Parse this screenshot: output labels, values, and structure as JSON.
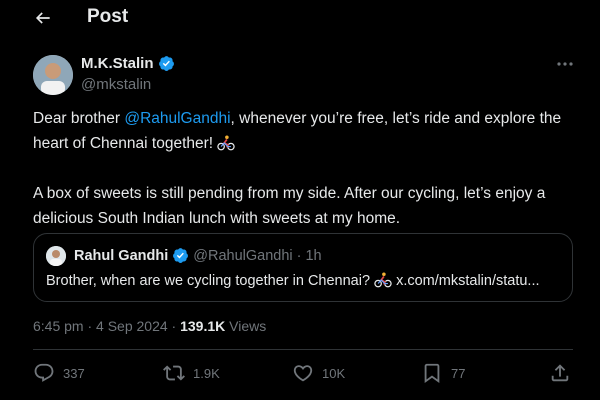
{
  "header": {
    "title": "Post"
  },
  "tweet": {
    "author_name": "M.K.Stalin",
    "author_handle": "@mkstalin",
    "para1_pre": "Dear brother ",
    "para1_mention": "@RahulGandhi",
    "para1_post": ", whenever you’re free, let’s ride and explore the heart of Chennai together! ",
    "para2": "A box of sweets is still pending from my side. After our cycling, let’s enjoy a delicious South Indian lunch with sweets at my home.",
    "timestamp": "6:45 pm · 4 Sep 2024 · ",
    "views_count": "139.1K",
    "views_label": " Views"
  },
  "quote": {
    "name": "Rahul Gandhi",
    "handle": "@RahulGandhi",
    "time": "· 1h",
    "text_main": "Brother, when are we cycling together in Chennai? ",
    "text_link": " x.com/mkstalin/statu..."
  },
  "actions": {
    "replies": "337",
    "reposts": "1.9K",
    "likes": "10K",
    "bookmarks": "77"
  },
  "colors": {
    "accent": "#1d9bf0",
    "muted": "#71767b",
    "text": "#e7e9ea",
    "border": "#2f3336"
  },
  "icons": [
    "back-arrow-icon",
    "verified-icon",
    "more-icon",
    "cyclist-emoji-icon",
    "reply-icon",
    "repost-icon",
    "like-icon",
    "bookmark-icon",
    "share-icon"
  ]
}
